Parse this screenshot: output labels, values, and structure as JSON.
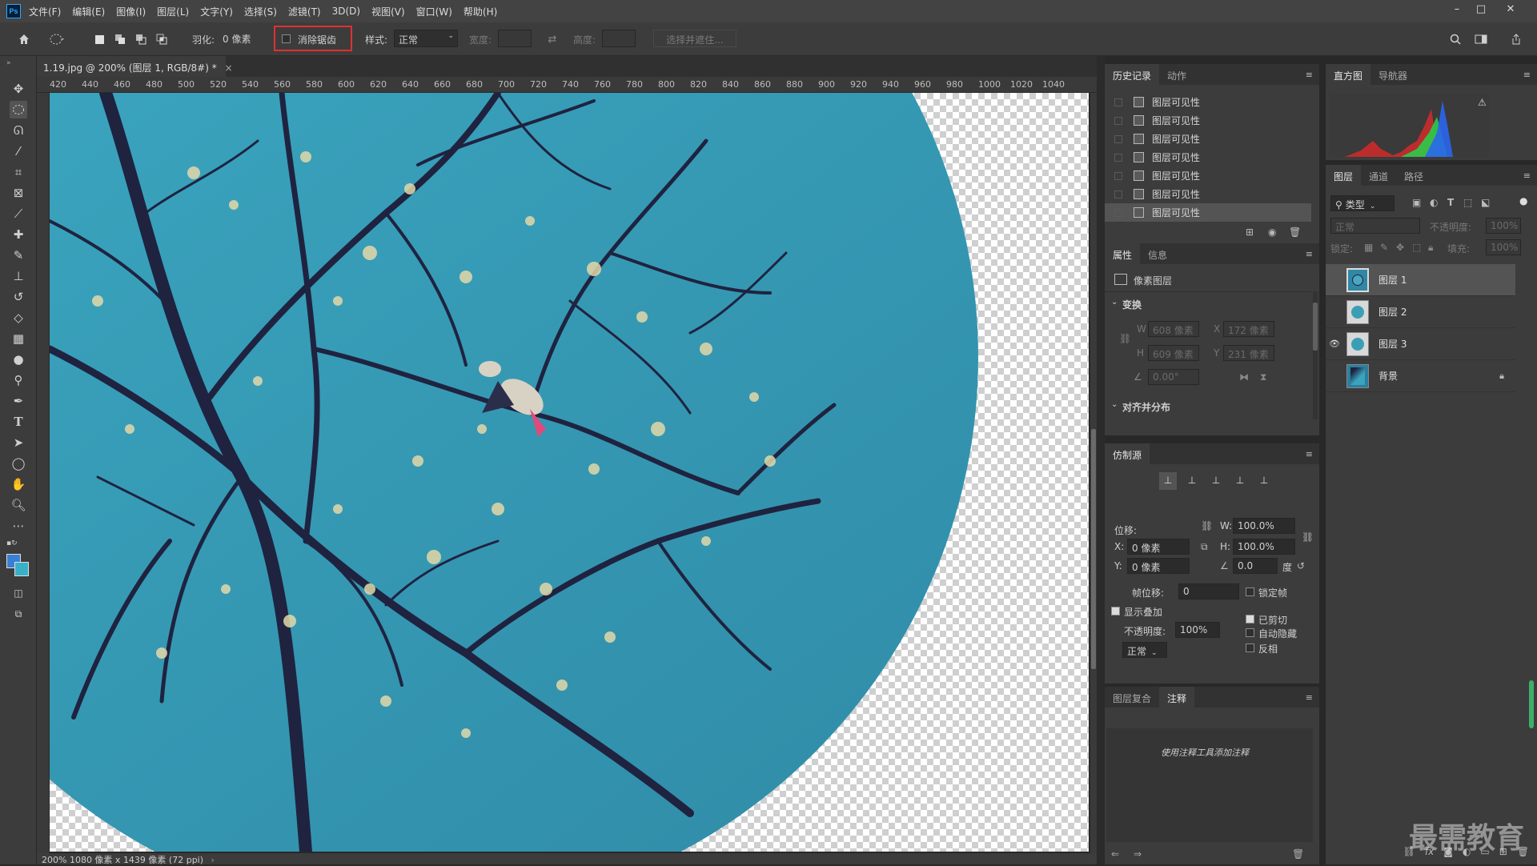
{
  "menubar": {
    "logo": "Ps",
    "items": [
      "文件(F)",
      "编辑(E)",
      "图像(I)",
      "图层(L)",
      "文字(Y)",
      "选择(S)",
      "滤镜(T)",
      "3D(D)",
      "视图(V)",
      "窗口(W)",
      "帮助(H)"
    ]
  },
  "options": {
    "feather_label": "羽化:",
    "feather_value": "0 像素",
    "antialias_label": "消除锯齿",
    "antialias_checked": false,
    "style_label": "样式:",
    "style_value": "正常",
    "width_label": "宽度:",
    "height_label": "高度:",
    "select_mask_label": "选择并遮住..."
  },
  "document": {
    "tab_title": "1.19.jpg @ 200% (图层 1, RGB/8#) *",
    "status": "200%  1080 像素 x 1439 像素 (72 ppi)"
  },
  "ruler_top": [
    "420",
    "440",
    "460",
    "480",
    "500",
    "520",
    "540",
    "560",
    "580",
    "600",
    "620",
    "640",
    "660",
    "680",
    "700",
    "720",
    "740",
    "760",
    "780",
    "800",
    "820",
    "840",
    "860",
    "880",
    "900",
    "920",
    "940",
    "960",
    "980",
    "1000",
    "1020",
    "1040"
  ],
  "history_panel": {
    "tabs": [
      "历史记录",
      "动作"
    ],
    "items": [
      "图层可见性",
      "图层可见性",
      "图层可见性",
      "图层可见性",
      "图层可见性",
      "图层可见性",
      "图层可见性"
    ]
  },
  "properties_panel": {
    "tabs": [
      "属性",
      "信息"
    ],
    "layer_type": "像素图层",
    "transform_heading": "变换",
    "w_label": "W",
    "w_value": "608 像素",
    "h_label": "H",
    "h_value": "609 像素",
    "x_label": "X",
    "x_value": "172 像素",
    "y_label": "Y",
    "y_value": "231 像素",
    "angle_value": "0.00°",
    "align_heading": "对齐并分布"
  },
  "clone_source_panel": {
    "tab": "仿制源",
    "offset_label": "位移:",
    "x_label": "X:",
    "x_value": "0 像素",
    "y_label": "Y:",
    "y_value": "0 像素",
    "w_label": "W:",
    "w_value": "100.0%",
    "h_label": "H:",
    "h_value": "100.0%",
    "angle_value": "0.0",
    "angle_unit": "度",
    "frame_offset_label": "帧位移:",
    "frame_offset_value": "0",
    "lock_frame_label": "锁定帧",
    "show_overlay_label": "显示叠加",
    "show_overlay_checked": true,
    "opacity_label": "不透明度:",
    "opacity_value": "100%",
    "blend_value": "正常",
    "clipped_label": "已剪切",
    "clipped_checked": true,
    "auto_hide_label": "自动隐藏",
    "invert_label": "反相"
  },
  "notes_panel": {
    "tabs": [
      "图层复合",
      "注释"
    ],
    "hint": "使用注释工具添加注释"
  },
  "histogram_panel": {
    "tabs": [
      "直方图",
      "导航器"
    ]
  },
  "layers_panel": {
    "tabs": [
      "图层",
      "通道",
      "路径"
    ],
    "filter_label": "类型",
    "blend_mode": "正常",
    "opacity_label": "不透明度:",
    "opacity_value": "100%",
    "lock_label": "锁定:",
    "fill_label": "填充:",
    "fill_value": "100%",
    "layers": [
      {
        "name": "图层 1",
        "visible": false,
        "selected": true
      },
      {
        "name": "图层 2",
        "visible": false,
        "selected": false
      },
      {
        "name": "图层 3",
        "visible": true,
        "selected": false
      },
      {
        "name": "背景",
        "visible": false,
        "selected": false,
        "locked": true
      }
    ]
  },
  "watermark": "最需教育",
  "colors": {
    "sky": "#3a9fb5",
    "branch": "#1f2340",
    "highlight_box": "#e03030",
    "accent_blue": "#31a8ff"
  }
}
